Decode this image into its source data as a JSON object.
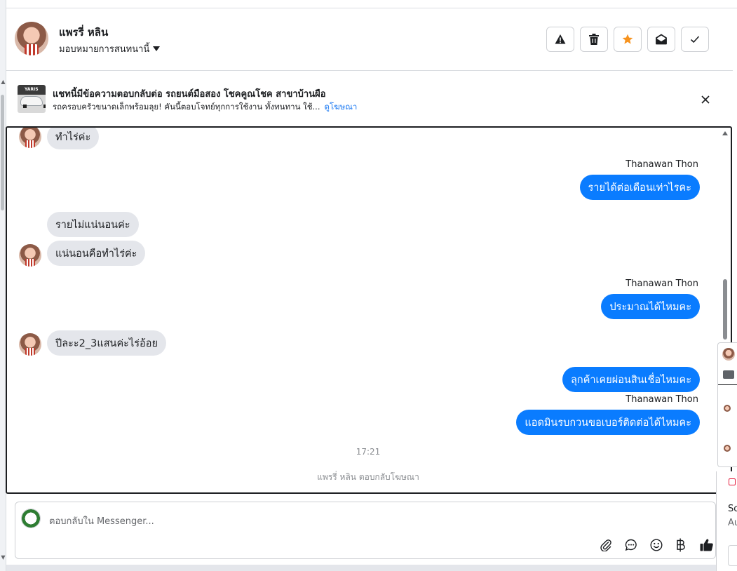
{
  "header": {
    "user_name": "แพรรี่ หลิน",
    "assign_label": "มอบหมายการสนทนานี้",
    "actions": [
      {
        "name": "report-spam-button",
        "icon": "warning-icon"
      },
      {
        "name": "delete-button",
        "icon": "trash-icon"
      },
      {
        "name": "star-button",
        "icon": "star-icon",
        "color": "#f7931e"
      },
      {
        "name": "mark-unread-button",
        "icon": "envelope-open-icon"
      },
      {
        "name": "mark-done-button",
        "icon": "check-icon"
      }
    ]
  },
  "ad_banner": {
    "image_tag": "YARIS",
    "title": "แชทนี้มีข้อความตอบกลับต่อ รถยนต์มือสอง โชคคูณโชค สาขาบ้านผือ",
    "subtitle": "รถครอบครัวขนาดเล็กพร้อมลุย! คันนี้ตอบโจทย์ทุกการใช้งาน ทั้งทนทาน ใช้...",
    "link": "ดูโฆษณา"
  },
  "conversation": {
    "messages": [
      {
        "dir": "in",
        "text": "ทำไร่ค่ะ"
      },
      {
        "dir": "out",
        "sender": "Thanawan Thon",
        "text": "รายได้ต่อเดือนเท่าไรคะ"
      },
      {
        "dir": "in",
        "text": "รายไม่แน่นอนค่ะ"
      },
      {
        "dir": "in",
        "text": "แน่นอนคือทำไร่ค่ะ"
      },
      {
        "dir": "out",
        "sender": "Thanawan Thon",
        "text": "ประมาณได้ไหมคะ"
      },
      {
        "dir": "in",
        "text": "ปีละะ2_3แสนค่ะไร่อ้อย"
      },
      {
        "dir": "out",
        "text": "ลุกค้าเคยผ่อนสินเชื่อไหมคะ"
      },
      {
        "dir": "out",
        "sender": "Thanawan Thon",
        "text": "แอดมินรบกวนขอเบอร์ติดต่อได้ไหมคะ"
      }
    ],
    "timestamp": "17:21",
    "system_note": "แพรรี่ หลิน ตอบกลับโฆษณา"
  },
  "composer": {
    "placeholder": "ตอบกลับใน Messenger...",
    "tools": [
      "attach-icon",
      "saved-reply-icon",
      "emoji-icon",
      "baht-payment-icon",
      "thumbs-up-icon"
    ]
  },
  "side_panel": {
    "text_1": "So",
    "text_2": "Au"
  },
  "colors": {
    "outgoing_bubble": "#0a7cff",
    "incoming_bubble": "#e4e6eb",
    "link": "#1877f2",
    "star": "#f7931e"
  }
}
